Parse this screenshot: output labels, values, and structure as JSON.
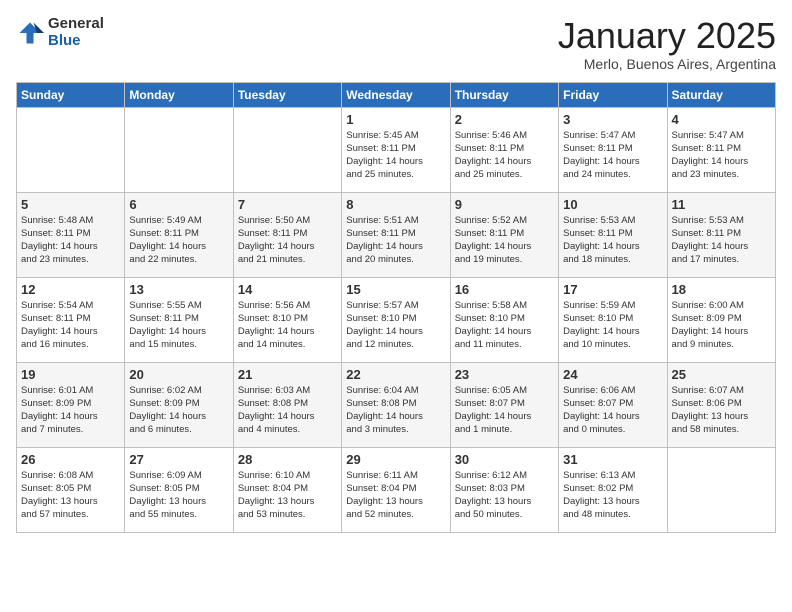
{
  "logo": {
    "general": "General",
    "blue": "Blue"
  },
  "title": "January 2025",
  "subtitle": "Merlo, Buenos Aires, Argentina",
  "days_of_week": [
    "Sunday",
    "Monday",
    "Tuesday",
    "Wednesday",
    "Thursday",
    "Friday",
    "Saturday"
  ],
  "weeks": [
    [
      {
        "day": "",
        "info": ""
      },
      {
        "day": "",
        "info": ""
      },
      {
        "day": "",
        "info": ""
      },
      {
        "day": "1",
        "info": "Sunrise: 5:45 AM\nSunset: 8:11 PM\nDaylight: 14 hours\nand 25 minutes."
      },
      {
        "day": "2",
        "info": "Sunrise: 5:46 AM\nSunset: 8:11 PM\nDaylight: 14 hours\nand 25 minutes."
      },
      {
        "day": "3",
        "info": "Sunrise: 5:47 AM\nSunset: 8:11 PM\nDaylight: 14 hours\nand 24 minutes."
      },
      {
        "day": "4",
        "info": "Sunrise: 5:47 AM\nSunset: 8:11 PM\nDaylight: 14 hours\nand 23 minutes."
      }
    ],
    [
      {
        "day": "5",
        "info": "Sunrise: 5:48 AM\nSunset: 8:11 PM\nDaylight: 14 hours\nand 23 minutes."
      },
      {
        "day": "6",
        "info": "Sunrise: 5:49 AM\nSunset: 8:11 PM\nDaylight: 14 hours\nand 22 minutes."
      },
      {
        "day": "7",
        "info": "Sunrise: 5:50 AM\nSunset: 8:11 PM\nDaylight: 14 hours\nand 21 minutes."
      },
      {
        "day": "8",
        "info": "Sunrise: 5:51 AM\nSunset: 8:11 PM\nDaylight: 14 hours\nand 20 minutes."
      },
      {
        "day": "9",
        "info": "Sunrise: 5:52 AM\nSunset: 8:11 PM\nDaylight: 14 hours\nand 19 minutes."
      },
      {
        "day": "10",
        "info": "Sunrise: 5:53 AM\nSunset: 8:11 PM\nDaylight: 14 hours\nand 18 minutes."
      },
      {
        "day": "11",
        "info": "Sunrise: 5:53 AM\nSunset: 8:11 PM\nDaylight: 14 hours\nand 17 minutes."
      }
    ],
    [
      {
        "day": "12",
        "info": "Sunrise: 5:54 AM\nSunset: 8:11 PM\nDaylight: 14 hours\nand 16 minutes."
      },
      {
        "day": "13",
        "info": "Sunrise: 5:55 AM\nSunset: 8:11 PM\nDaylight: 14 hours\nand 15 minutes."
      },
      {
        "day": "14",
        "info": "Sunrise: 5:56 AM\nSunset: 8:10 PM\nDaylight: 14 hours\nand 14 minutes."
      },
      {
        "day": "15",
        "info": "Sunrise: 5:57 AM\nSunset: 8:10 PM\nDaylight: 14 hours\nand 12 minutes."
      },
      {
        "day": "16",
        "info": "Sunrise: 5:58 AM\nSunset: 8:10 PM\nDaylight: 14 hours\nand 11 minutes."
      },
      {
        "day": "17",
        "info": "Sunrise: 5:59 AM\nSunset: 8:10 PM\nDaylight: 14 hours\nand 10 minutes."
      },
      {
        "day": "18",
        "info": "Sunrise: 6:00 AM\nSunset: 8:09 PM\nDaylight: 14 hours\nand 9 minutes."
      }
    ],
    [
      {
        "day": "19",
        "info": "Sunrise: 6:01 AM\nSunset: 8:09 PM\nDaylight: 14 hours\nand 7 minutes."
      },
      {
        "day": "20",
        "info": "Sunrise: 6:02 AM\nSunset: 8:09 PM\nDaylight: 14 hours\nand 6 minutes."
      },
      {
        "day": "21",
        "info": "Sunrise: 6:03 AM\nSunset: 8:08 PM\nDaylight: 14 hours\nand 4 minutes."
      },
      {
        "day": "22",
        "info": "Sunrise: 6:04 AM\nSunset: 8:08 PM\nDaylight: 14 hours\nand 3 minutes."
      },
      {
        "day": "23",
        "info": "Sunrise: 6:05 AM\nSunset: 8:07 PM\nDaylight: 14 hours\nand 1 minute."
      },
      {
        "day": "24",
        "info": "Sunrise: 6:06 AM\nSunset: 8:07 PM\nDaylight: 14 hours\nand 0 minutes."
      },
      {
        "day": "25",
        "info": "Sunrise: 6:07 AM\nSunset: 8:06 PM\nDaylight: 13 hours\nand 58 minutes."
      }
    ],
    [
      {
        "day": "26",
        "info": "Sunrise: 6:08 AM\nSunset: 8:05 PM\nDaylight: 13 hours\nand 57 minutes."
      },
      {
        "day": "27",
        "info": "Sunrise: 6:09 AM\nSunset: 8:05 PM\nDaylight: 13 hours\nand 55 minutes."
      },
      {
        "day": "28",
        "info": "Sunrise: 6:10 AM\nSunset: 8:04 PM\nDaylight: 13 hours\nand 53 minutes."
      },
      {
        "day": "29",
        "info": "Sunrise: 6:11 AM\nSunset: 8:04 PM\nDaylight: 13 hours\nand 52 minutes."
      },
      {
        "day": "30",
        "info": "Sunrise: 6:12 AM\nSunset: 8:03 PM\nDaylight: 13 hours\nand 50 minutes."
      },
      {
        "day": "31",
        "info": "Sunrise: 6:13 AM\nSunset: 8:02 PM\nDaylight: 13 hours\nand 48 minutes."
      },
      {
        "day": "",
        "info": ""
      }
    ]
  ]
}
